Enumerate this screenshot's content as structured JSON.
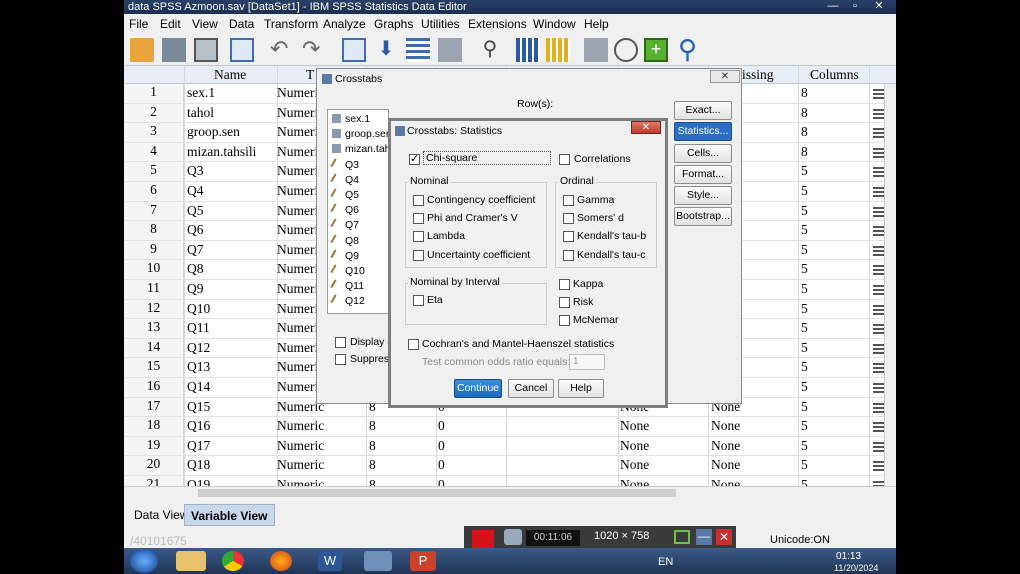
{
  "window": {
    "title": "data SPSS Azmoon.sav [DataSet1] - IBM SPSS Statistics Data Editor",
    "controls": [
      "—",
      "▫",
      "✕"
    ]
  },
  "menubar": [
    "File",
    "Edit",
    "View",
    "Data",
    "Transform",
    "Analyze",
    "Graphs",
    "Utilities",
    "Extensions",
    "Window",
    "Help"
  ],
  "toolbar_icons": [
    "open-folder-icon",
    "save-icon",
    "print-icon",
    "dialog-recall-icon",
    "undo-icon",
    "redo-icon",
    "goto-case-icon",
    "goto-variable-icon",
    "variables-icon",
    "run-descriptives-icon",
    "find-icon",
    "split-file-icon",
    "weight-cases-icon",
    "select-cases-icon",
    "value-labels-icon",
    "use-sets-icon",
    "spell-icon"
  ],
  "grid": {
    "headers": {
      "name": "Name",
      "t": "T",
      "columns": "Columns",
      "missing": "issing"
    },
    "rows": [
      {
        "n": "1",
        "name": "sex.1",
        "type": "Numeric",
        "w": "",
        "d": "",
        "v": "",
        "m": "",
        "col": "8"
      },
      {
        "n": "2",
        "name": "tahol",
        "type": "Numeric",
        "w": "",
        "d": "",
        "v": "",
        "m": "",
        "col": "8"
      },
      {
        "n": "3",
        "name": "groop.sen",
        "type": "Numeric",
        "w": "",
        "d": "",
        "v": "",
        "m": "",
        "col": "8"
      },
      {
        "n": "4",
        "name": "mizan.tahsili",
        "type": "Numeric",
        "w": "",
        "d": "",
        "v": "",
        "m": "",
        "col": "8"
      },
      {
        "n": "5",
        "name": "Q3",
        "type": "Numeric",
        "w": "",
        "d": "",
        "v": "",
        "m": "",
        "col": "5"
      },
      {
        "n": "6",
        "name": "Q4",
        "type": "Numeric",
        "w": "",
        "d": "",
        "v": "",
        "m": "",
        "col": "5"
      },
      {
        "n": "7",
        "name": "Q5",
        "type": "Numeric",
        "w": "",
        "d": "",
        "v": "",
        "m": "",
        "col": "5"
      },
      {
        "n": "8",
        "name": "Q6",
        "type": "Numeric",
        "w": "",
        "d": "",
        "v": "",
        "m": "",
        "col": "5"
      },
      {
        "n": "9",
        "name": "Q7",
        "type": "Numeric",
        "w": "",
        "d": "",
        "v": "",
        "m": "",
        "col": "5"
      },
      {
        "n": "10",
        "name": "Q8",
        "type": "Numeric",
        "w": "",
        "d": "",
        "v": "",
        "m": "",
        "col": "5"
      },
      {
        "n": "11",
        "name": "Q9",
        "type": "Numeric",
        "w": "",
        "d": "",
        "v": "",
        "m": "",
        "col": "5"
      },
      {
        "n": "12",
        "name": "Q10",
        "type": "Numeric",
        "w": "",
        "d": "",
        "v": "",
        "m": "",
        "col": "5"
      },
      {
        "n": "13",
        "name": "Q11",
        "type": "Numeric",
        "w": "",
        "d": "",
        "v": "",
        "m": "",
        "col": "5"
      },
      {
        "n": "14",
        "name": "Q12",
        "type": "Numeric",
        "w": "",
        "d": "",
        "v": "",
        "m": "",
        "col": "5"
      },
      {
        "n": "15",
        "name": "Q13",
        "type": "Numeric",
        "w": "",
        "d": "",
        "v": "",
        "m": "",
        "col": "5"
      },
      {
        "n": "16",
        "name": "Q14",
        "type": "Numeric",
        "w": "",
        "d": "",
        "v": "",
        "m": "",
        "col": "5"
      },
      {
        "n": "17",
        "name": "Q15",
        "type": "Numeric",
        "w": "8",
        "d": "0",
        "v": "None",
        "m": "None",
        "col": "5"
      },
      {
        "n": "18",
        "name": "Q16",
        "type": "Numeric",
        "w": "8",
        "d": "0",
        "v": "None",
        "m": "None",
        "col": "5"
      },
      {
        "n": "19",
        "name": "Q17",
        "type": "Numeric",
        "w": "8",
        "d": "0",
        "v": "None",
        "m": "None",
        "col": "5"
      },
      {
        "n": "20",
        "name": "Q18",
        "type": "Numeric",
        "w": "8",
        "d": "0",
        "v": "None",
        "m": "None",
        "col": "5"
      },
      {
        "n": "21",
        "name": "Q19",
        "type": "Numeric",
        "w": "8",
        "d": "0",
        "v": "None",
        "m": "None",
        "col": "5"
      }
    ]
  },
  "tabs": {
    "data_view": "Data View",
    "variable_view": "Variable View"
  },
  "status": {
    "unicode": "Unicode:ON",
    "watermark": "/40101675"
  },
  "crosstabs": {
    "title": "Crosstabs",
    "rows_label": "Row(s):",
    "variables": [
      "sex.1",
      "groop.sen",
      "mizan.tah",
      "Q3",
      "Q4",
      "Q5",
      "Q6",
      "Q7",
      "Q8",
      "Q9",
      "Q10",
      "Q11",
      "Q12"
    ],
    "display_label": "Display c",
    "suppress_label": "Suppress",
    "buttons": [
      "Exact...",
      "Statistics...",
      "Cells...",
      "Format...",
      "Style...",
      "Bootstrap..."
    ]
  },
  "statistics": {
    "title": "Crosstabs: Statistics",
    "chi_square": "Chi-square",
    "correlations": "Correlations",
    "nominal": {
      "title": "Nominal",
      "items": [
        "Contingency coefficient",
        "Phi and Cramer's V",
        "Lambda",
        "Uncertainty coefficient"
      ]
    },
    "ordinal": {
      "title": "Ordinal",
      "items": [
        "Gamma",
        "Somers' d",
        "Kendall's tau-b",
        "Kendall's tau-c"
      ]
    },
    "nominal_interval": {
      "title": "Nominal by Interval",
      "eta": "Eta"
    },
    "right_items": [
      "Kappa",
      "Risk",
      "McNemar"
    ],
    "cochran": "Cochran's and Mantel-Haenszel statistics",
    "odds_label": "Test common odds ratio equals:",
    "odds_value": "1",
    "buttons": {
      "continue": "Continue",
      "cancel": "Cancel",
      "help": "Help"
    }
  },
  "recorder": {
    "size": "1020 × 758",
    "timer": "00:11:06"
  },
  "taskbar": {
    "lang": "EN",
    "time": "01:13",
    "date": "11/20/2024"
  }
}
